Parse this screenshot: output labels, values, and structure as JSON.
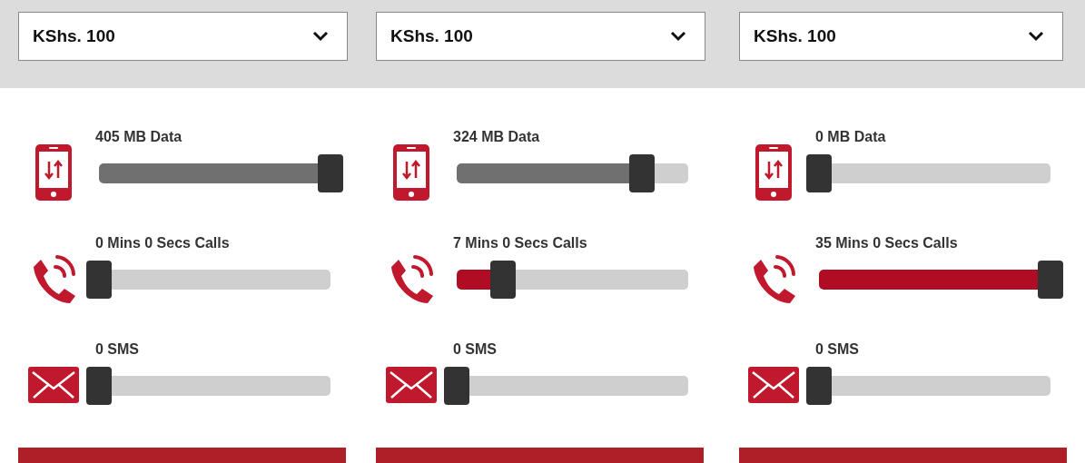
{
  "plans": [
    {
      "amount": "KShs. 100",
      "rows": [
        {
          "kind": "data",
          "label": "405 MB Data",
          "level": 1
        },
        {
          "kind": "calls",
          "label": "0 Mins 0 Secs Calls",
          "level": 0
        },
        {
          "kind": "sms",
          "label": "0 SMS",
          "level": 0
        }
      ]
    },
    {
      "amount": "KShs. 100",
      "rows": [
        {
          "kind": "data",
          "label": "324 MB Data",
          "level": 0.8
        },
        {
          "kind": "calls",
          "label": "7 Mins 0 Secs Calls",
          "level": 0.2
        },
        {
          "kind": "sms",
          "label": "0 SMS",
          "level": 0
        }
      ]
    },
    {
      "amount": "KShs. 100",
      "rows": [
        {
          "kind": "data",
          "label": "0 MB Data",
          "level": 0
        },
        {
          "kind": "calls",
          "label": "35 Mins 0 Secs Calls",
          "level": 1
        },
        {
          "kind": "sms",
          "label": "0 SMS",
          "level": 0
        }
      ]
    }
  ]
}
